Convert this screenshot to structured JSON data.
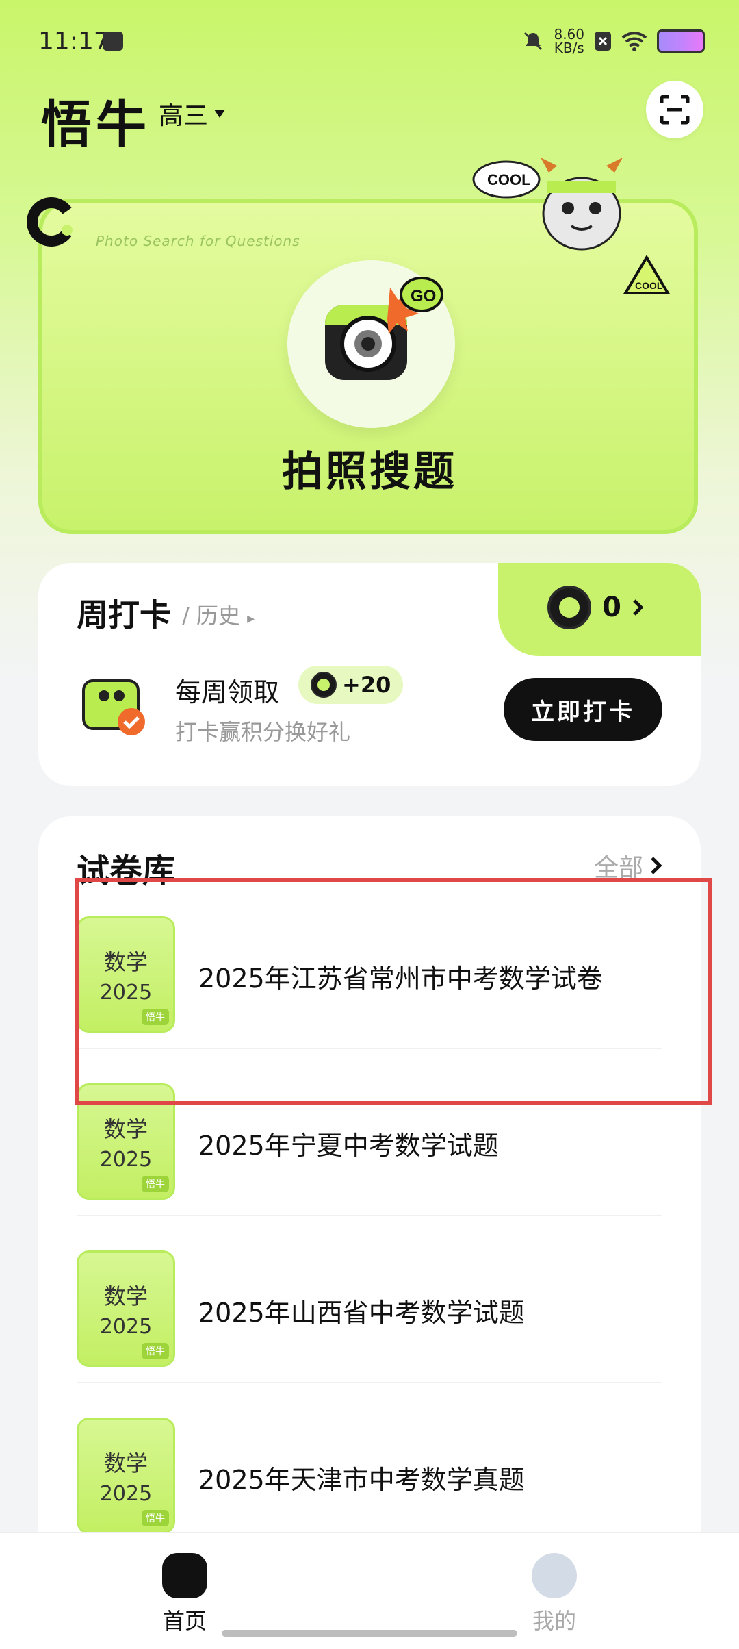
{
  "status_bar": {
    "time": "11:17",
    "speed_value": "8.60",
    "speed_unit": "KB/s"
  },
  "header": {
    "app_name": "悟牛",
    "grade": "高三"
  },
  "photo_search": {
    "subtitle": "Photo Search for Questions",
    "title": "拍照搜题",
    "go": "GO",
    "cool": "COOL"
  },
  "weekly_checkin": {
    "title": "周打卡",
    "history": "/ 历史",
    "coin_count": "0",
    "main_text": "每周领取",
    "reward": "+20",
    "sub_text": "打卡赢积分换好礼",
    "button": "立即打卡"
  },
  "paper_library": {
    "title": "试卷库",
    "all_label": "全部",
    "items": [
      {
        "subject": "数学",
        "year": "2025",
        "name": "2025年江苏省常州市中考数学试卷",
        "mark": "悟牛"
      },
      {
        "subject": "数学",
        "year": "2025",
        "name": "2025年宁夏中考数学试题",
        "mark": "悟牛"
      },
      {
        "subject": "数学",
        "year": "2025",
        "name": "2025年山西省中考数学试题",
        "mark": "悟牛"
      },
      {
        "subject": "数学",
        "year": "2025",
        "name": "2025年天津市中考数学真题",
        "mark": "悟牛"
      }
    ]
  },
  "bottom_nav": {
    "home": "首页",
    "me": "我的"
  }
}
